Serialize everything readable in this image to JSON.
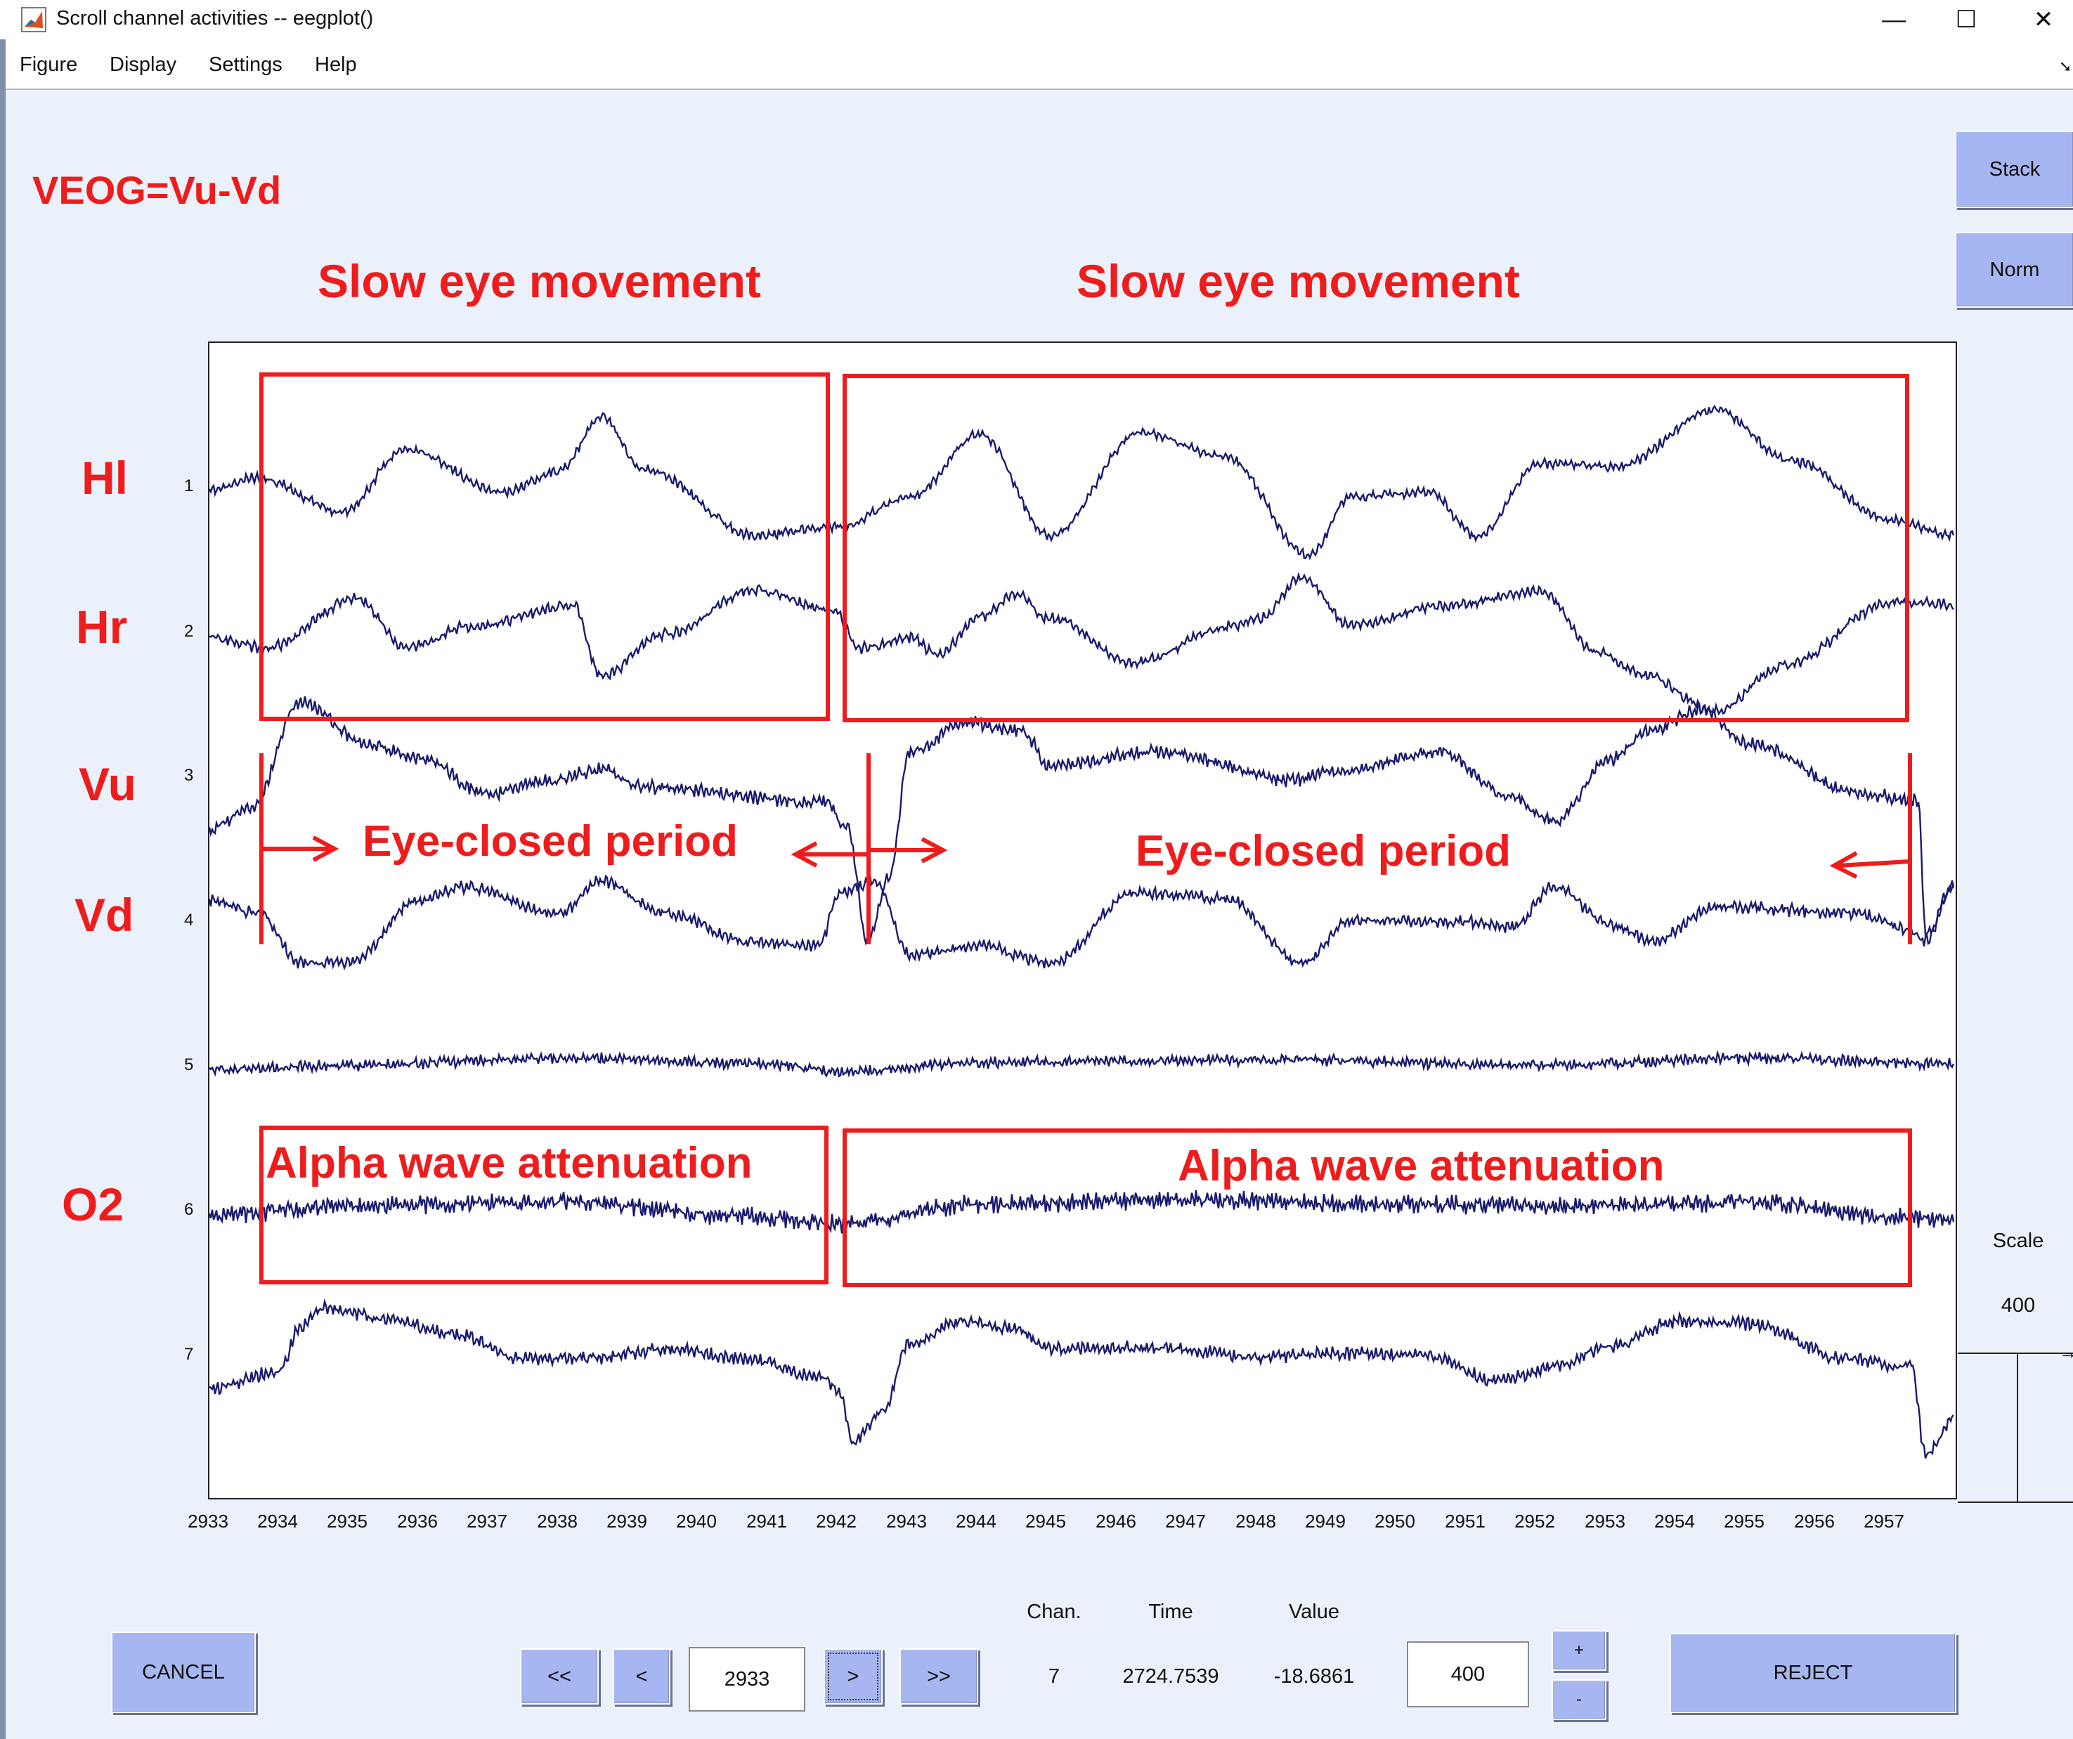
{
  "window": {
    "title": "Scroll channel activities -- eegplot()",
    "icon": "matlab-icon",
    "controls": {
      "minimize": "—",
      "maximize": "☐",
      "close": "✕"
    }
  },
  "menu": [
    "Figure",
    "Display",
    "Settings",
    "Help"
  ],
  "side_buttons": {
    "stack": "Stack",
    "norm": "Norm"
  },
  "scale": {
    "label": "Scale",
    "value": "400"
  },
  "channels": [
    "1",
    "2",
    "3",
    "4",
    "5",
    "6",
    "7"
  ],
  "x_ticks": [
    "2933",
    "2934",
    "2935",
    "2936",
    "2937",
    "2938",
    "2939",
    "2940",
    "2941",
    "2942",
    "2943",
    "2944",
    "2945",
    "2946",
    "2947",
    "2948",
    "2949",
    "2950",
    "2951",
    "2952",
    "2953",
    "2954",
    "2955",
    "2956",
    "2957"
  ],
  "bottom": {
    "cancel": "CANCEL",
    "nav_first": "<<",
    "nav_prev": "<",
    "position": "2933",
    "nav_next": ">",
    "nav_last": ">>",
    "chan_header": "Chan.",
    "time_header": "Time",
    "value_header": "Value",
    "chan_value": "7",
    "time_value": "2724.7539",
    "value_value": "-18.6861",
    "scale_input": "400",
    "plus": "+",
    "minus": "-",
    "reject": "REJECT"
  },
  "annotations": {
    "veog": "VEOG=Vu-Vd",
    "slow_eye_1": "Slow eye movement",
    "slow_eye_2": "Slow eye movement",
    "eye_closed_1": "Eye-closed period",
    "eye_closed_2": "Eye-closed period",
    "alpha_1": "Alpha wave attenuation",
    "alpha_2": "Alpha wave attenuation",
    "label_hl": "Hl",
    "label_hr": "Hr",
    "label_vu": "Vu",
    "label_vd": "Vd",
    "label_o2": "O2"
  },
  "colors": {
    "trace": "#1a1a6e",
    "annotation": "#ee1c1c",
    "button": "#a6b6f0",
    "background": "#eaf1fa"
  }
}
